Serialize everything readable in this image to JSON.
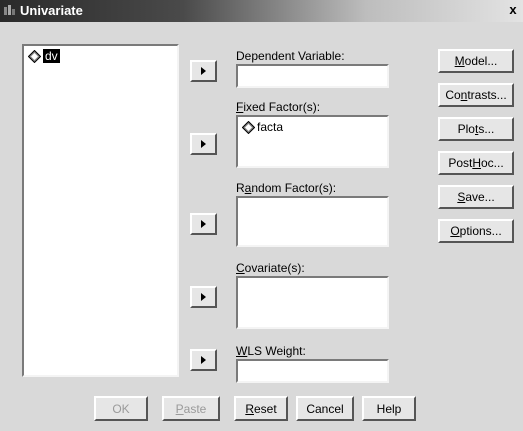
{
  "window": {
    "title": "Univariate",
    "close_glyph": "x"
  },
  "source_variables": [
    {
      "label": "dv",
      "selected": true
    }
  ],
  "targets": {
    "dependent": {
      "label": "Dependent Variable:"
    },
    "fixed": {
      "label_mn": "F",
      "label_rest": "ixed Factor(s):",
      "items": [
        "facta"
      ]
    },
    "random": {
      "label_pre": "R",
      "label_mn": "a",
      "label_rest": "ndom Factor(s):"
    },
    "covariate": {
      "label_mn": "C",
      "label_rest": "ovariate(s):"
    },
    "wls": {
      "label_mn": "W",
      "label_rest": "LS Weight:"
    }
  },
  "side_buttons": {
    "model": {
      "mn": "M",
      "rest": "odel..."
    },
    "contrasts": {
      "pre": "Co",
      "mn": "n",
      "rest": "trasts..."
    },
    "plots": {
      "pre": "Plo",
      "mn": "t",
      "rest": "s..."
    },
    "posthoc": {
      "pre": "Post ",
      "mn": "H",
      "rest": "oc..."
    },
    "save": {
      "mn": "S",
      "rest": "ave..."
    },
    "options": {
      "mn": "O",
      "rest": "ptions..."
    }
  },
  "bottom_buttons": {
    "ok": {
      "label": "OK",
      "enabled": false
    },
    "paste": {
      "mn": "P",
      "rest": "aste",
      "enabled": false
    },
    "reset": {
      "mn": "R",
      "rest": "eset",
      "enabled": true
    },
    "cancel": {
      "label": "Cancel",
      "enabled": true
    },
    "help": {
      "label": "Help",
      "enabled": true
    }
  },
  "icons": {
    "title": "spss-app-icon",
    "variable": "scale-variable-icon",
    "transfer": "right-arrow-icon"
  },
  "colors": {
    "titlebar_dark": "#2a2a2a",
    "dialog_bg": "#d9d9d9",
    "selection": "#000000"
  }
}
